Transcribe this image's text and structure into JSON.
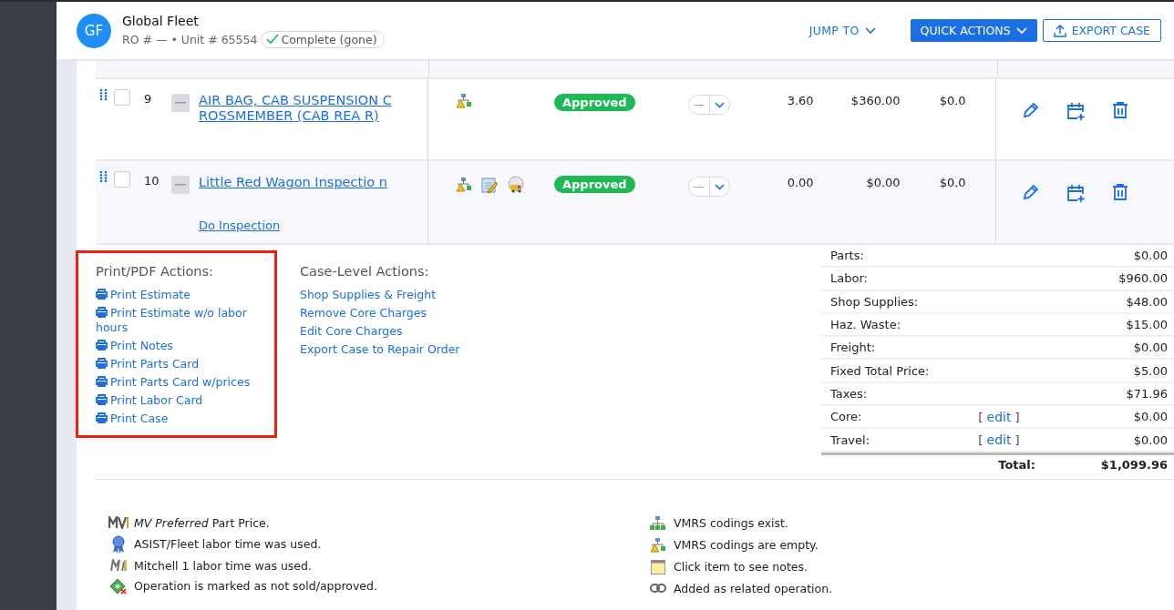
{
  "header": {
    "avatar": "GF",
    "title": "Global Fleet",
    "subtitle": "RO # — • Unit # 65554",
    "status": "Complete (gone)",
    "jump_to": "JUMP TO",
    "quick_actions": "QUICK ACTIONS",
    "export": "EXPORT CASE"
  },
  "rows": [
    {
      "number": "9",
      "checked": false,
      "title": "AIR BAG, CAB SUSPENSION CROSSMEMBER (CAB REA R)",
      "icons": [
        {
          "kind": "warning"
        }
      ],
      "status": "Approved",
      "select": "—",
      "hours": "3.60",
      "amount": "$360.00",
      "column_7": "$0.0"
    },
    {
      "number": "10",
      "checked": false,
      "title": "Little Red Wagon Inspectio n",
      "link": "Do Inspection",
      "icons": [
        {
          "kind": "warning"
        },
        {
          "kind": "pencil"
        },
        {
          "kind": "truck"
        }
      ],
      "status": "Approved",
      "select": "—",
      "hours": "0.00",
      "amount": "$0.00",
      "column_7": "$0.0"
    }
  ],
  "print_actions": {
    "heading": "Print/PDF Actions:",
    "items": [
      "Print Estimate",
      "Print Estimate w/o labor hours",
      "Print Notes",
      "Print Parts Card",
      "Print Parts Card w/prices",
      "Print Labor Card",
      "Print Case"
    ]
  },
  "case_actions": {
    "heading": "Case-Level Actions:",
    "items": [
      "Shop Supplies & Freight",
      "Remove Core Charges",
      "Edit Core Charges",
      "Export Case to Repair Order"
    ]
  },
  "summary": {
    "rows": [
      {
        "label": "Parts:",
        "value": "$0.00"
      },
      {
        "label": "Labor:",
        "value": "$960.00"
      },
      {
        "label": "Shop Supplies:",
        "value": "$48.00"
      },
      {
        "label": "Haz. Waste:",
        "value": "$15.00"
      },
      {
        "label": "Freight:",
        "value": "$0.00"
      },
      {
        "label": "Fixed Total Price:",
        "value": "$5.00"
      },
      {
        "label": "Taxes:",
        "value": "$71.96"
      },
      {
        "label": "Core:",
        "open": "[",
        "edit": "edit",
        "close": "]",
        "value": "$0.00"
      },
      {
        "label": "Travel:",
        "open": "[",
        "edit": "edit",
        "close": "]",
        "value": "$0.00"
      }
    ],
    "total_label": "Total:",
    "total_value": "$1,099.96"
  },
  "legend": {
    "left": [
      {
        "kind": "stripes",
        "text": "*MV Preferred* Part Price."
      },
      {
        "kind": "ribbon",
        "text": "ASIST/Fleet labor time was used."
      },
      {
        "kind": "brand",
        "text": "Mitchell 1 labor time was used."
      },
      {
        "kind": "cash",
        "text": "Operation is marked as not sold/approved."
      }
    ],
    "right": [
      {
        "kind": "tree",
        "text": "VMRS codings exist."
      },
      {
        "kind": "warning",
        "text": "VMRS codings are empty."
      },
      {
        "kind": "note",
        "text": "Click item to see notes."
      },
      {
        "kind": "chain",
        "text": "Added as related operation."
      }
    ]
  }
}
